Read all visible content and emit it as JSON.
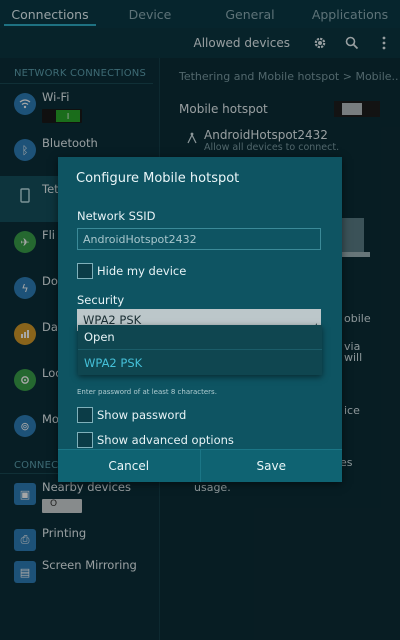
{
  "tabs": [
    "Connections",
    "Device",
    "General",
    "Applications"
  ],
  "actionbar": {
    "allowed_devices": "Allowed devices",
    "icons": [
      "gear-icon",
      "search-icon",
      "more-icon"
    ]
  },
  "left": {
    "section1": "NETWORK CONNECTIONS",
    "section2": "CONNECTI",
    "items": [
      {
        "label": "Wi-Fi",
        "icon": "wifi-icon",
        "color": "#2d7fb8",
        "toggle": "on"
      },
      {
        "label": "Bluetooth",
        "icon": "bluetooth-icon",
        "color": "#2d7fb8",
        "toggle": "C"
      },
      {
        "label": "Tet",
        "icon": "tethering-icon",
        "color": "#2d7fb8"
      },
      {
        "label": "Fli",
        "icon": "airplane-icon",
        "color": "#3aa04a",
        "toggle": "C"
      },
      {
        "label": "Dov",
        "icon": "download-booster-icon",
        "color": "#2d7fb8",
        "toggle": "C"
      },
      {
        "label": "Dat",
        "icon": "data-usage-icon",
        "color": "#d39a2a"
      },
      {
        "label": "Loc",
        "icon": "location-icon",
        "color": "#3aa04a",
        "toggle": "C"
      },
      {
        "label": "Mo",
        "icon": "more-networks-icon",
        "color": "#2d7fb8"
      },
      {
        "label": "Nearby devices",
        "icon": "nearby-devices-icon",
        "color": "#2d7fb8"
      },
      {
        "label": "Printing",
        "icon": "printer-icon",
        "color": "#2d7fb8"
      },
      {
        "label": "Screen Mirroring",
        "icon": "screen-mirroring-icon",
        "color": "#2d7fb8"
      }
    ],
    "wifi_toggle_text": "I",
    "nearby_toggle_text": "O"
  },
  "right": {
    "breadcrumb": "Tethering and Mobile hotspot  >  Mobile..",
    "mobile_hotspot": "Mobile hotspot",
    "hotspot_name": "AndroidHotspot2432",
    "hotspot_sub": "Allow all devices to connect.",
    "frag1": "obile",
    "frag2": "via",
    "frag3": "will",
    "frag4": "ice",
    "frag5": "es",
    "frag6": "usage."
  },
  "dialog": {
    "title": "Configure Mobile hotspot",
    "ssid_label": "Network SSID",
    "ssid_value": "AndroidHotspot2432",
    "hide_device": "Hide my device",
    "security_label": "Security",
    "security_value": "WPA2 PSK",
    "options": [
      "Open",
      "WPA2 PSK"
    ],
    "hint": "Enter password of at least 8 characters.",
    "show_password": "Show password",
    "show_advanced": "Show advanced options",
    "cancel": "Cancel",
    "save": "Save"
  }
}
